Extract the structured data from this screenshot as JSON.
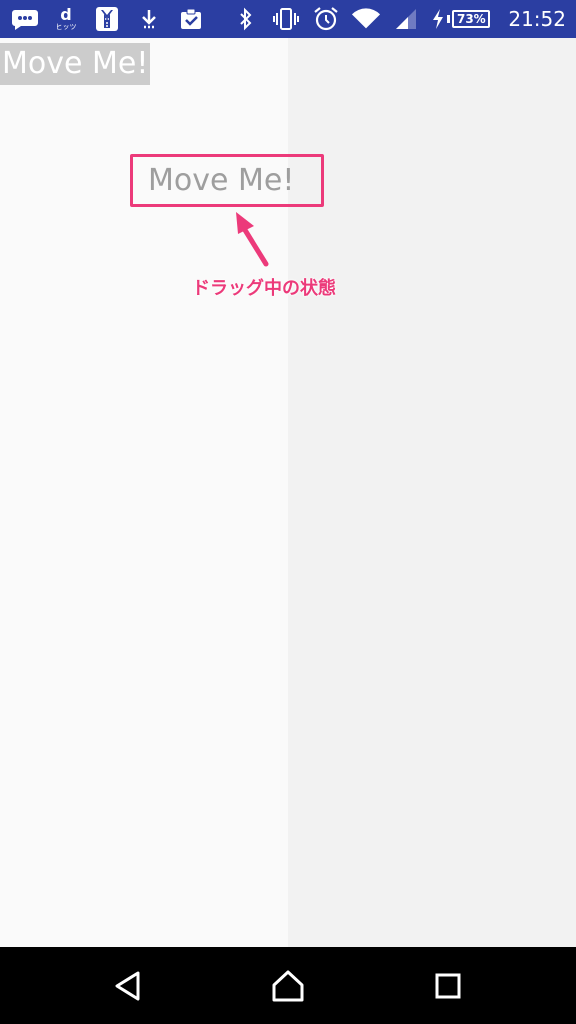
{
  "status_bar": {
    "left_icons": [
      "message-icon",
      "docomo-d-icon",
      "tuxedo-app-icon",
      "download-icon",
      "clipboard-check-icon"
    ],
    "docomo_letter": "d",
    "docomo_sub": "ヒッツ",
    "right_icons": [
      "bluetooth-icon",
      "vibrate-icon",
      "alarm-icon",
      "wifi-icon",
      "cell-signal-icon",
      "charging-icon"
    ],
    "battery_percent": "73%",
    "time": "21:52",
    "background_color": "#2b3ea2"
  },
  "content": {
    "draggable_label": "Move Me!",
    "drag_shadow_label": "Move Me!",
    "annotation": "ドラッグ中の状態",
    "accent_color": "#ec3a7a"
  },
  "nav_bar": {
    "buttons": [
      "back-icon",
      "home-icon",
      "recents-icon"
    ]
  }
}
